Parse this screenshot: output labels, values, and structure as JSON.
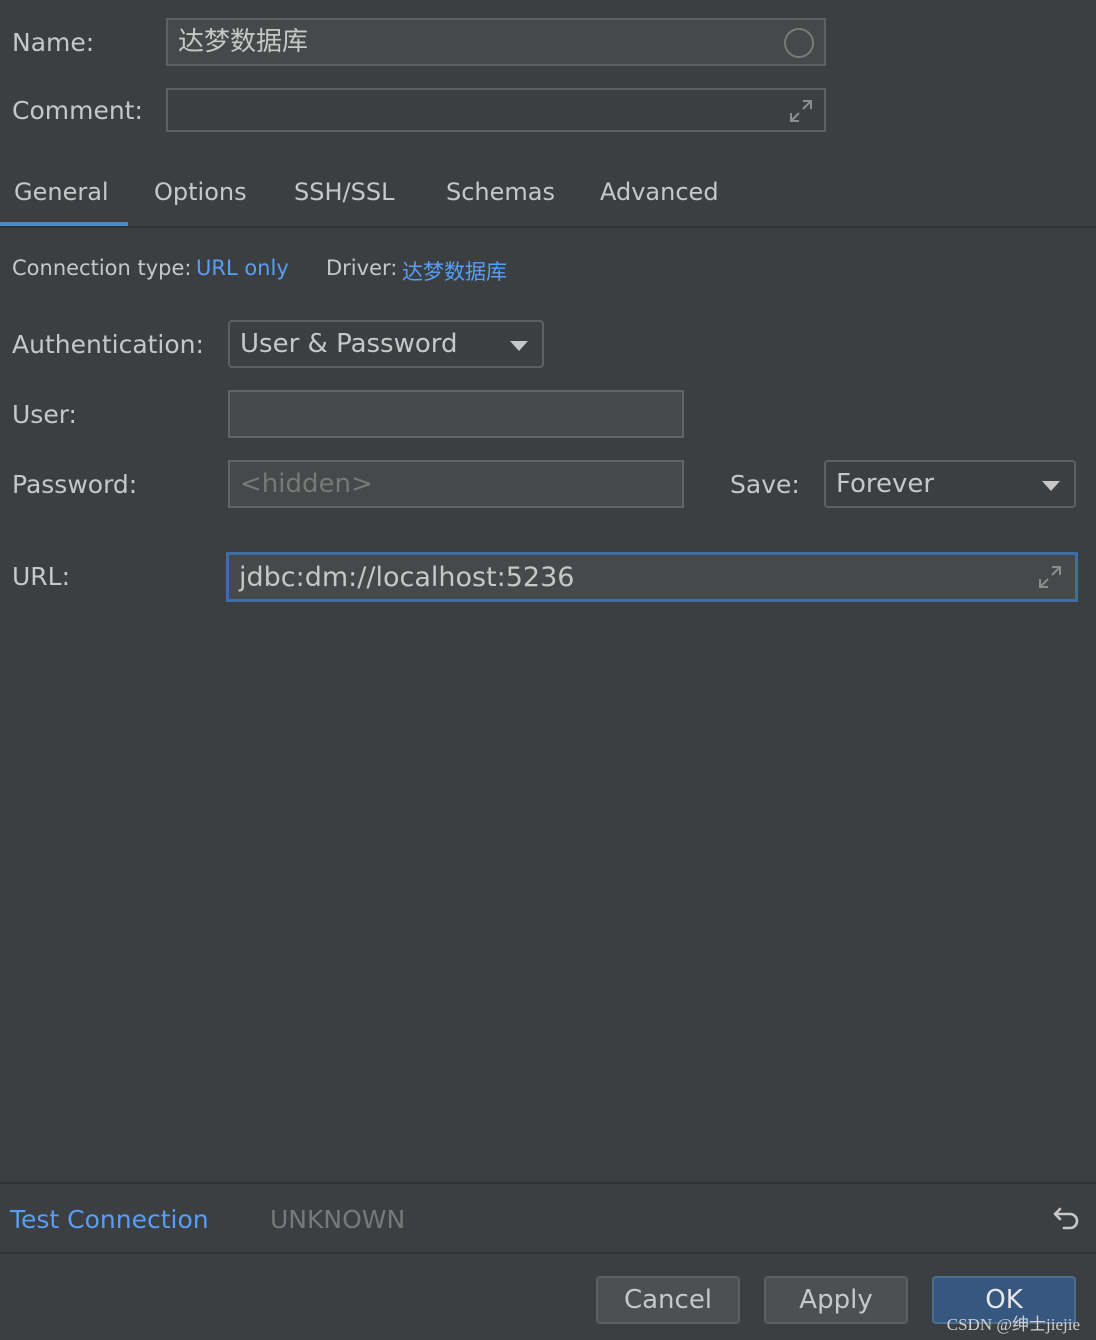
{
  "form": {
    "name_label": "Name:",
    "name_value": "达梦数据库",
    "comment_label": "Comment:",
    "comment_value": ""
  },
  "tabs": [
    {
      "label": "General",
      "active": true
    },
    {
      "label": "Options"
    },
    {
      "label": "SSH/SSL"
    },
    {
      "label": "Schemas"
    },
    {
      "label": "Advanced"
    }
  ],
  "general": {
    "connection_type_label": "Connection type:",
    "connection_type_value": "URL only",
    "driver_label": "Driver:",
    "driver_value": "达梦数据库",
    "auth_label": "Authentication:",
    "auth_value": "User & Password",
    "user_label": "User:",
    "user_value": "",
    "password_label": "Password:",
    "password_placeholder": "<hidden>",
    "save_label": "Save:",
    "save_value": "Forever",
    "url_label": "URL:",
    "url_value": "jdbc:dm://localhost:5236"
  },
  "status": {
    "test_connection": "Test Connection",
    "result": "UNKNOWN"
  },
  "buttons": {
    "cancel": "Cancel",
    "apply": "Apply",
    "ok": "OK"
  },
  "watermark": "CSDN @绅士jiejie",
  "colors": {
    "background": "#3c3f41",
    "link": "#589df6",
    "tab_underline": "#4a88c7",
    "focus_border": "#3d6fa5",
    "ok_button": "#365880"
  }
}
